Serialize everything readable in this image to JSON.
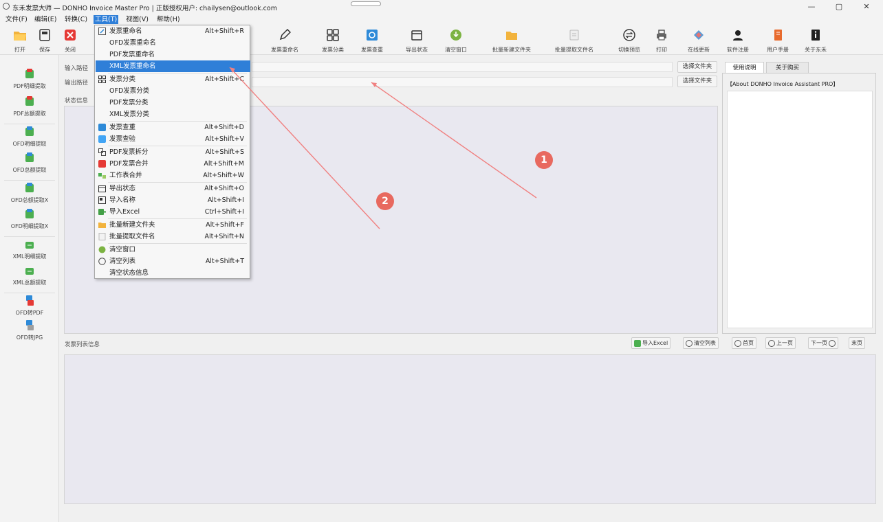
{
  "window": {
    "title": "东禾发票大师 — DONHO Invoice Master Pro | 正版授权用户: chailysen@outlook.com",
    "min": "—",
    "max": "▢",
    "close": "✕"
  },
  "menubar": [
    "文件(F)",
    "编辑(E)",
    "转换(C)",
    "工具(T)",
    "视图(V)",
    "帮助(H)"
  ],
  "toolbar": [
    "打开",
    "保存",
    "关闭",
    "发票重命名",
    "发票分类",
    "发票查重",
    "导出状态",
    "清空窗口",
    "批量新建文件夹",
    "批量提取文件名",
    "切换预览",
    "打印",
    "在线更新",
    "软件注册",
    "用户手册",
    "关于东禾"
  ],
  "sidebar": [
    "PDF明细提取",
    "PDF总额提取",
    "OFD明细提取",
    "OFD总额提取",
    "OFD总额提取X",
    "OFD明细提取X",
    "XML明细提取",
    "XML总额提取",
    "OFD转PDF",
    "OFD转JPG"
  ],
  "main": {
    "input_label": "输入路径",
    "output_label": "输出路径",
    "select_folder": "选择文件夹",
    "status_label": "状态信息",
    "list_label": "发票列表信息"
  },
  "right": {
    "tabs": [
      "使用说明",
      "关于购买"
    ],
    "about_text": "【About DONHO Invoice Assistant PRO】"
  },
  "list_buttons": [
    "导入Excel",
    "清空列表",
    "首页",
    "上一页",
    "下一页",
    "末页"
  ],
  "dropdown": [
    {
      "label": "发票重命名",
      "shortcut": "Alt+Shift+R"
    },
    {
      "label": "OFD发票重命名",
      "shortcut": ""
    },
    {
      "label": "PDF发票重命名",
      "shortcut": ""
    },
    {
      "label": "XML发票重命名",
      "shortcut": ""
    },
    {
      "label": "发票分类",
      "shortcut": "Alt+Shift+C"
    },
    {
      "label": "OFD发票分类",
      "shortcut": ""
    },
    {
      "label": "PDF发票分类",
      "shortcut": ""
    },
    {
      "label": "XML发票分类",
      "shortcut": ""
    },
    {
      "label": "发票查重",
      "shortcut": "Alt+Shift+D"
    },
    {
      "label": "发票查验",
      "shortcut": "Alt+Shift+V"
    },
    {
      "label": "PDF发票拆分",
      "shortcut": "Alt+Shift+S"
    },
    {
      "label": "PDF发票合并",
      "shortcut": "Alt+Shift+M"
    },
    {
      "label": "工作表合并",
      "shortcut": "Alt+Shift+W"
    },
    {
      "label": "导出状态",
      "shortcut": "Alt+Shift+O"
    },
    {
      "label": "导入名称",
      "shortcut": "Alt+Shift+I"
    },
    {
      "label": "导入Excel",
      "shortcut": "Ctrl+Shift+I"
    },
    {
      "label": "批量新建文件夹",
      "shortcut": "Alt+Shift+F"
    },
    {
      "label": "批量提取文件名",
      "shortcut": "Alt+Shift+N"
    },
    {
      "label": "清空窗口",
      "shortcut": ""
    },
    {
      "label": "清空列表",
      "shortcut": "Alt+Shift+T"
    },
    {
      "label": "清空状态信息",
      "shortcut": ""
    }
  ],
  "annotations": [
    "1",
    "2"
  ],
  "colors": {
    "highlight": "#2f7fd8",
    "annotation": "#e8695f"
  }
}
